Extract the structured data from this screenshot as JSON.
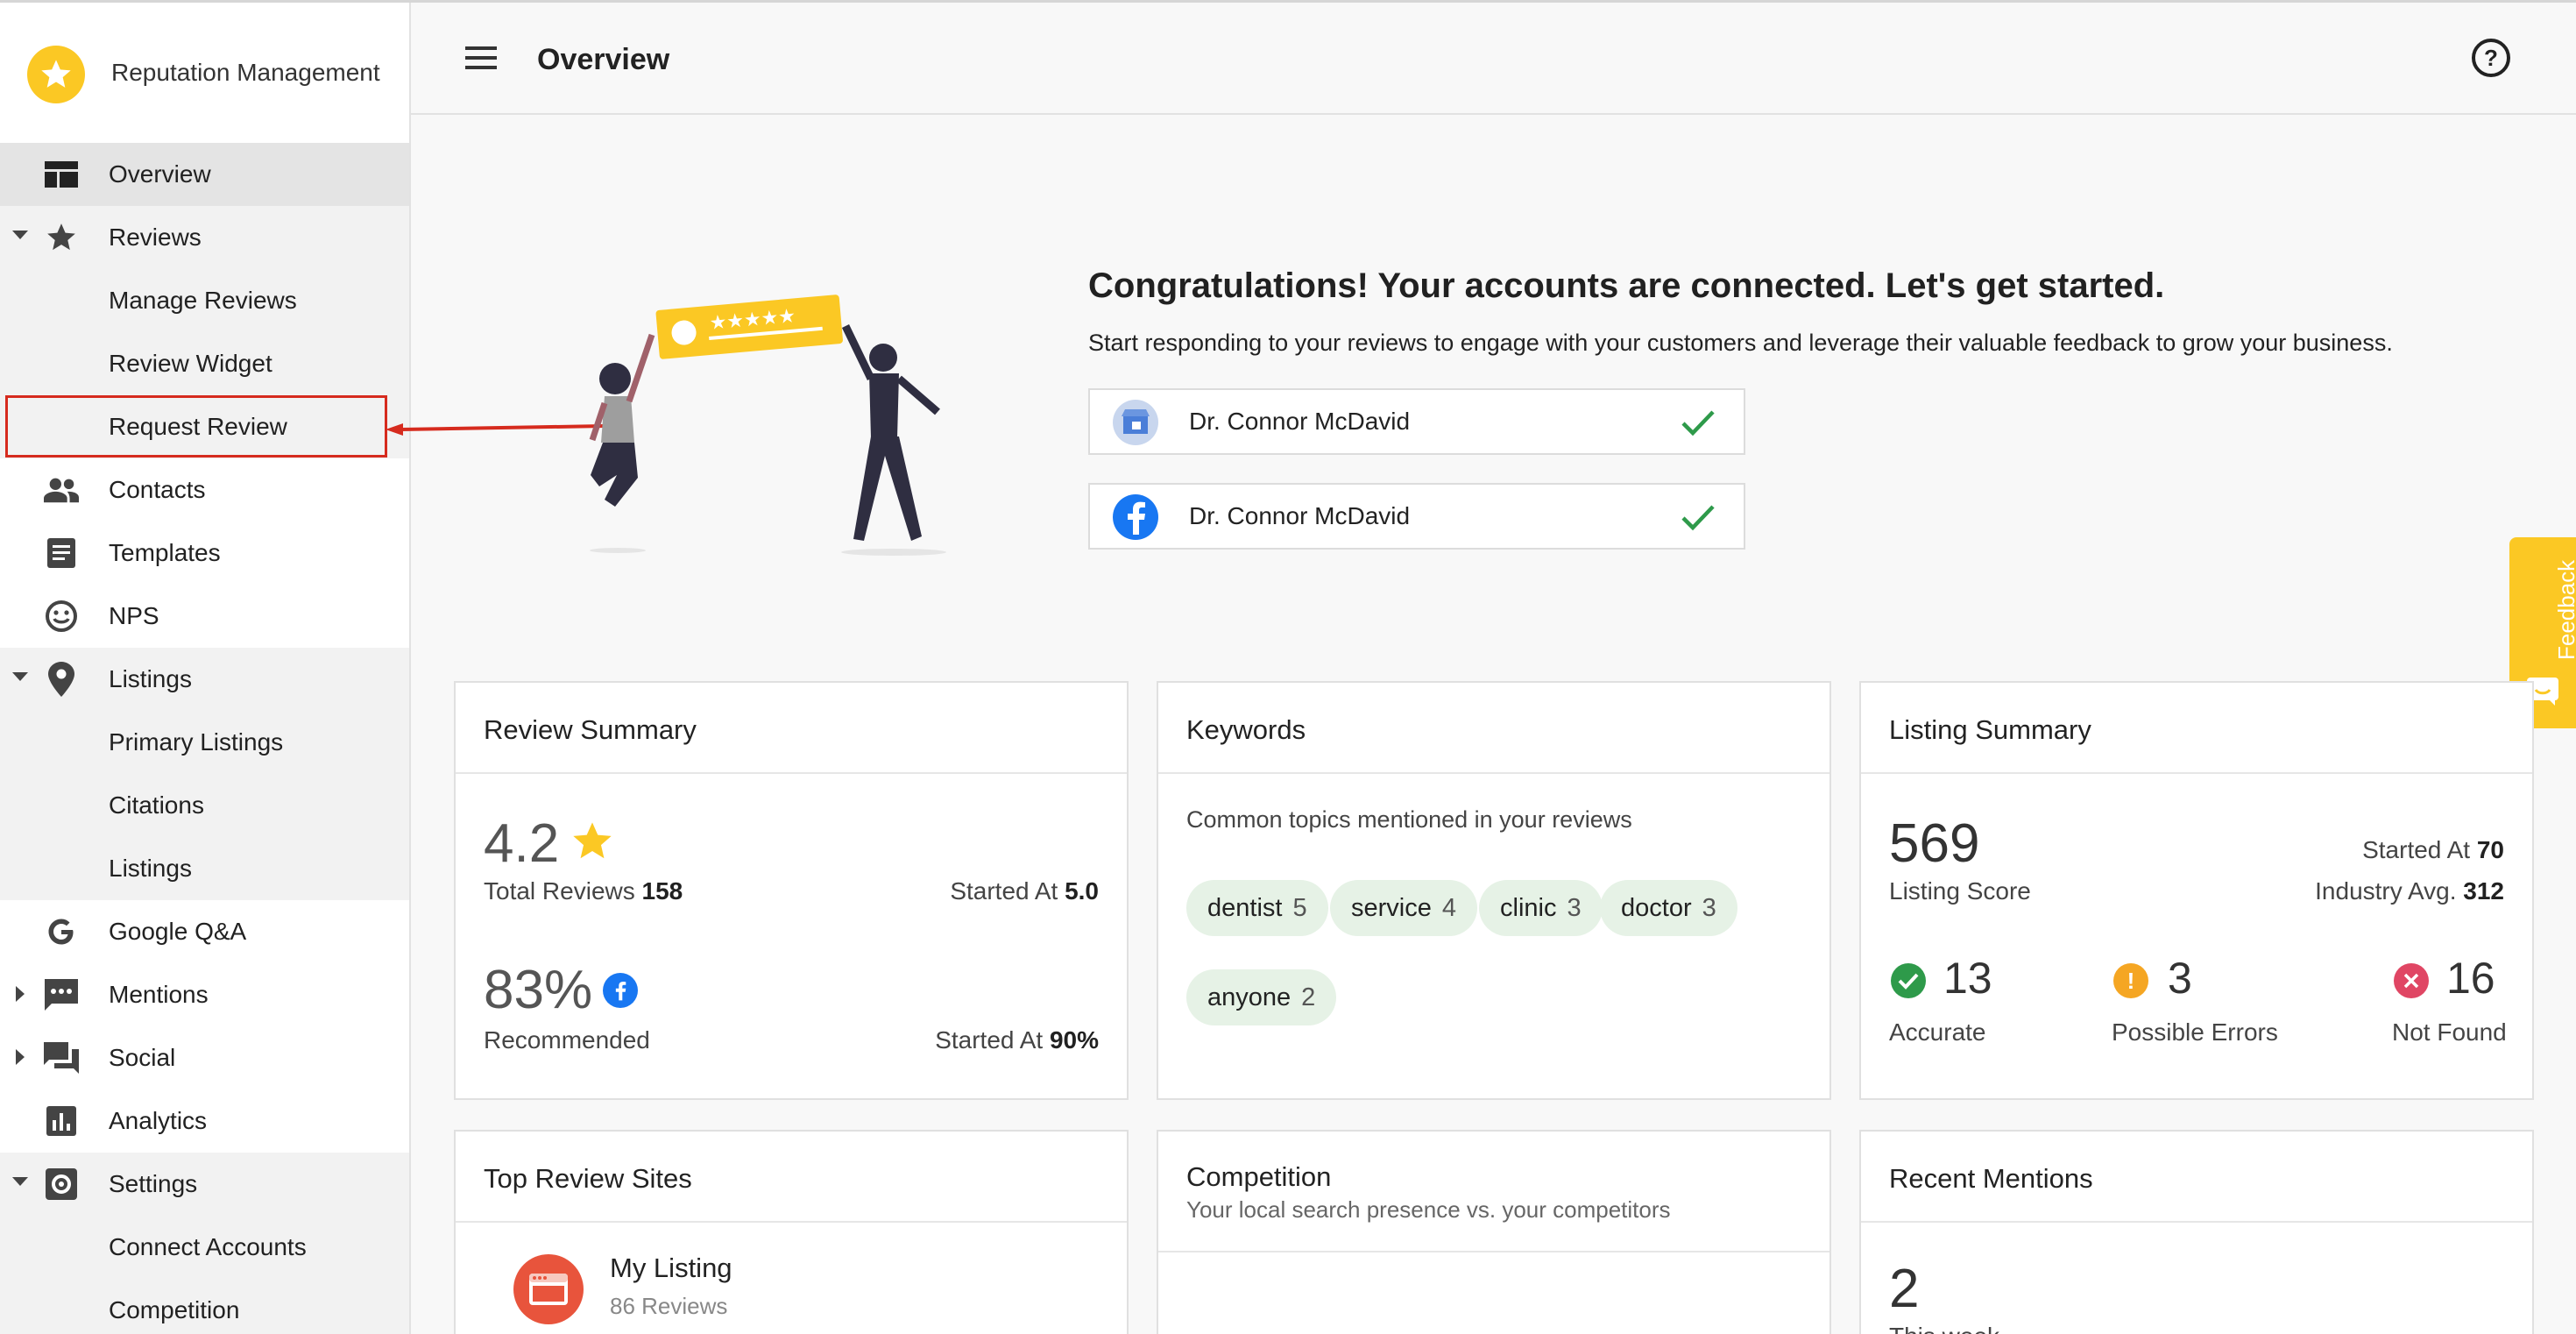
{
  "brand": {
    "title": "Reputation Management"
  },
  "header": {
    "title": "Overview",
    "help_symbol": "?"
  },
  "nav": [
    {
      "id": "overview",
      "label": "Overview",
      "icon": "dashboard-icon"
    },
    {
      "id": "reviews",
      "label": "Reviews",
      "icon": "star-icon"
    },
    {
      "id": "manage-reviews",
      "label": "Manage Reviews"
    },
    {
      "id": "review-widget",
      "label": "Review Widget"
    },
    {
      "id": "request-review",
      "label": "Request Review"
    },
    {
      "id": "contacts",
      "label": "Contacts",
      "icon": "people-icon"
    },
    {
      "id": "templates",
      "label": "Templates",
      "icon": "document-icon"
    },
    {
      "id": "nps",
      "label": "NPS",
      "icon": "smiley-icon"
    },
    {
      "id": "listings",
      "label": "Listings",
      "icon": "location-pin-icon"
    },
    {
      "id": "primary-listings",
      "label": "Primary Listings"
    },
    {
      "id": "citations",
      "label": "Citations"
    },
    {
      "id": "listings-sub",
      "label": "Listings"
    },
    {
      "id": "google-qa",
      "label": "Google Q&A",
      "icon": "google-icon"
    },
    {
      "id": "mentions",
      "label": "Mentions",
      "icon": "chat-dots-icon"
    },
    {
      "id": "social",
      "label": "Social",
      "icon": "forum-icon"
    },
    {
      "id": "analytics",
      "label": "Analytics",
      "icon": "bar-chart-icon"
    },
    {
      "id": "settings",
      "label": "Settings",
      "icon": "gear-icon"
    },
    {
      "id": "connect-accounts",
      "label": "Connect Accounts"
    },
    {
      "id": "competition",
      "label": "Competition"
    }
  ],
  "hero": {
    "title": "Congratulations! Your accounts are connected. Let's get started.",
    "subtitle": "Start responding to your reviews to engage with your customers and leverage their valuable feedback to grow your business.",
    "accounts": [
      {
        "name": "Dr. Connor McDavid",
        "source_icon": "google-my-business-icon"
      },
      {
        "name": "Dr. Connor McDavid",
        "source_icon": "facebook-icon"
      }
    ]
  },
  "feedback": {
    "label": "Feedback"
  },
  "review_summary": {
    "title": "Review Summary",
    "rating": "4.2",
    "total_label": "Total Reviews",
    "total_value": "158",
    "started_label": "Started At",
    "started_value": "5.0",
    "recommended_value": "83%",
    "recommended_label": "Recommended",
    "rec_started_label": "Started At",
    "rec_started_value": "90%"
  },
  "keywords": {
    "title": "Keywords",
    "subtitle": "Common topics mentioned in your reviews",
    "items": [
      {
        "word": "dentist",
        "count": "5"
      },
      {
        "word": "service",
        "count": "4"
      },
      {
        "word": "clinic",
        "count": "3"
      },
      {
        "word": "doctor",
        "count": "3"
      },
      {
        "word": "anyone",
        "count": "2"
      }
    ]
  },
  "listing_summary": {
    "title": "Listing Summary",
    "score": "569",
    "score_label": "Listing Score",
    "started_label": "Started At",
    "started_value": "70",
    "industry_label": "Industry Avg.",
    "industry_value": "312",
    "accurate_value": "13",
    "accurate_label": "Accurate",
    "errors_value": "3",
    "errors_label": "Possible Errors",
    "notfound_value": "16",
    "notfound_label": "Not Found"
  },
  "top_sites": {
    "title": "Top Review Sites",
    "site_name": "My Listing",
    "site_reviews": "86 Reviews"
  },
  "competition": {
    "title": "Competition",
    "subtitle": "Your local search presence vs. your competitors"
  },
  "recent_mentions": {
    "title": "Recent Mentions",
    "count": "2",
    "partial_label": "This week"
  },
  "colors": {
    "accent_yellow": "#fbc824",
    "check_green": "#2e9a4a",
    "warning_orange": "#f5a623",
    "error_red": "#e04664",
    "chip_bg": "#e6f2e6",
    "highlight_red": "#d62b1e"
  }
}
